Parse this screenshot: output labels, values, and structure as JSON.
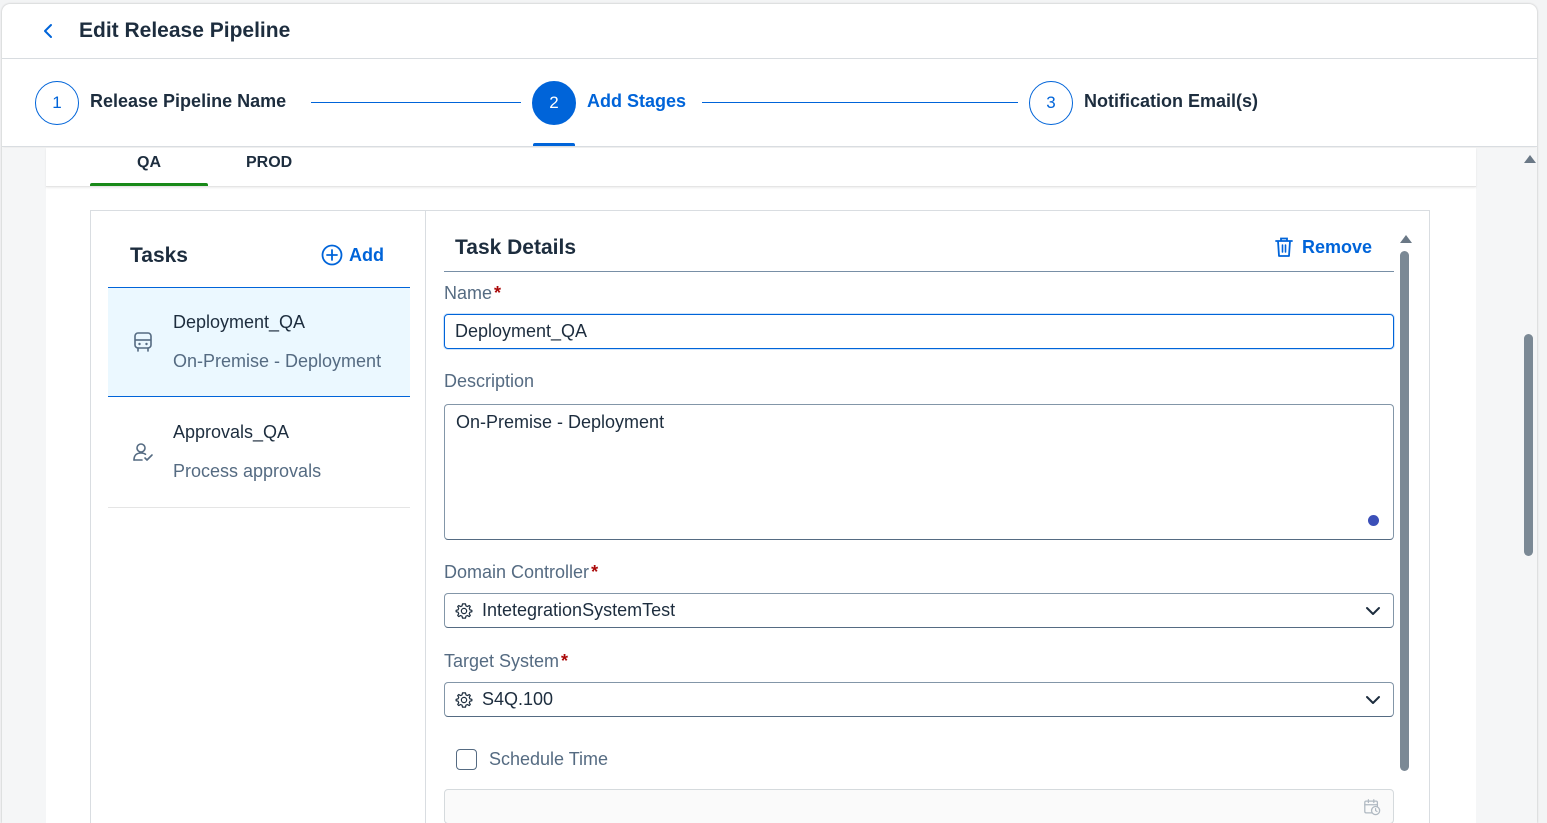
{
  "header": {
    "title": "Edit Release Pipeline"
  },
  "wizard": {
    "steps": [
      {
        "number": "1",
        "label": "Release Pipeline Name"
      },
      {
        "number": "2",
        "label": "Add Stages"
      },
      {
        "number": "3",
        "label": "Notification Email(s)"
      }
    ],
    "active_step": 2
  },
  "stage_tabs": [
    {
      "label": "QA",
      "selected": true
    },
    {
      "label": "PROD",
      "selected": false
    }
  ],
  "tasks": {
    "heading": "Tasks",
    "add_label": "Add",
    "items": [
      {
        "title": "Deployment_QA",
        "subtitle": "On-Premise - Deployment",
        "icon": "bus-icon",
        "selected": true
      },
      {
        "title": "Approvals_QA",
        "subtitle": "Process approvals",
        "icon": "user-check-icon",
        "selected": false
      }
    ]
  },
  "details": {
    "heading": "Task Details",
    "remove_label": "Remove",
    "name_label": "Name",
    "name_value": "Deployment_QA",
    "description_label": "Description",
    "description_value": "On-Premise - Deployment",
    "domain_label": "Domain Controller",
    "domain_value": "IntetegrationSystemTest",
    "target_label": "Target System",
    "target_value": "S4Q.100",
    "schedule_label": "Schedule Time",
    "schedule_checked": false,
    "required_marker": "*"
  },
  "colors": {
    "accent": "#0064d9",
    "tab_underline": "#188918",
    "required": "#aa0808",
    "selected_item_bg": "#ebf8ff"
  }
}
